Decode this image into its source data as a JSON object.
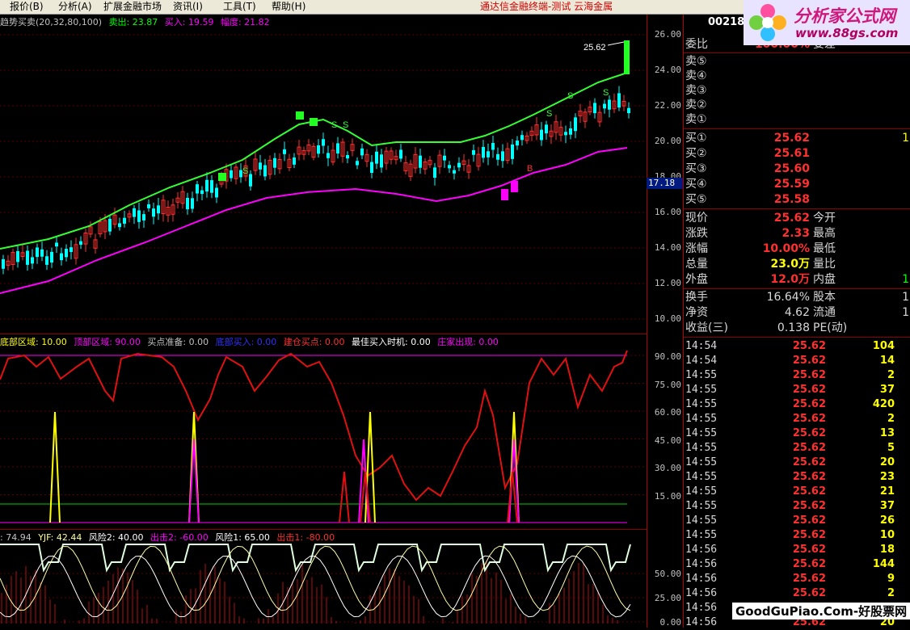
{
  "menu": {
    "items": [
      "报价(B)",
      "分析(A)",
      "扩展金融市场",
      "资讯(I)",
      "工具(T)",
      "帮助(H)"
    ],
    "app_title": "通达信金融终端-测试  云海金属"
  },
  "logo": {
    "brand": "分析家公式网",
    "url": "www.88gs.com"
  },
  "pane1": {
    "legend": [
      {
        "text": "趋势买卖(20,32,80,100)",
        "color": "#c0c0c0"
      },
      {
        "text": "卖出: 23.87",
        "color": "#00ff00"
      },
      {
        "text": "买入: 19.59",
        "color": "#ff00ff"
      },
      {
        "text": "幅度: 21.82",
        "color": "#ff00ff"
      }
    ],
    "last_price_label": "25.62",
    "marker_labels": [
      "S",
      "S",
      "S",
      "S",
      "B",
      "S",
      "S"
    ]
  },
  "pane2": {
    "legend": [
      {
        "text": "底部区域: 10.00",
        "color": "#ffff00"
      },
      {
        "text": "顶部区域: 90.00",
        "color": "#ff00ff"
      },
      {
        "text": "买点准备: 0.00",
        "color": "#c0c0c0"
      },
      {
        "text": "底部买入: 0.00",
        "color": "#3030ff"
      },
      {
        "text": "建仓买点: 0.00",
        "color": "#ff3030"
      },
      {
        "text": "最佳买入时机: 0.00",
        "color": "#ffffff"
      },
      {
        "text": "庄家出现: 0.00",
        "color": "#ff00ff"
      }
    ]
  },
  "pane3": {
    "legend": [
      {
        "text": ": 74.94",
        "color": "#c0c0c0"
      },
      {
        "text": "YJF: 42.44",
        "color": "#ffff99"
      },
      {
        "text": "风险2: 40.00",
        "color": "#ffffff"
      },
      {
        "text": "出击2: -60.00",
        "color": "#ff00ff"
      },
      {
        "text": "风险1: 65.00",
        "color": "#ffffff"
      },
      {
        "text": "出击1: -80.00",
        "color": "#ff3030"
      }
    ]
  },
  "axis": {
    "pane1_ticks": [
      "26.00",
      "24.00",
      "22.00",
      "20.00",
      "18.00",
      "16.00",
      "14.00",
      "12.00",
      "10.00"
    ],
    "pane2_ticks": [
      "90.00",
      "75.00",
      "60.00",
      "45.00",
      "30.00",
      "15.00"
    ],
    "pane3_ticks": [
      "50.00",
      "25.00",
      "0.00"
    ],
    "current_price_tag": "17.18"
  },
  "quote": {
    "code": "002182",
    "weibi": {
      "label": "委比",
      "value": "100.00%",
      "label2": "委差"
    },
    "sell": [
      {
        "label": "卖⑤"
      },
      {
        "label": "卖④"
      },
      {
        "label": "卖③"
      },
      {
        "label": "卖②"
      },
      {
        "label": "卖①"
      }
    ],
    "buy": [
      {
        "label": "买①",
        "price": "25.62",
        "vol": "1"
      },
      {
        "label": "买②",
        "price": "25.61",
        "vol": ""
      },
      {
        "label": "买③",
        "price": "25.60",
        "vol": ""
      },
      {
        "label": "买④",
        "price": "25.59",
        "vol": ""
      },
      {
        "label": "买⑤",
        "price": "25.58",
        "vol": ""
      }
    ],
    "stats": [
      {
        "label": "现价",
        "value": "25.62",
        "label2": "今开",
        "value2": ""
      },
      {
        "label": "涨跌",
        "value": "2.33",
        "label2": "最高",
        "value2": ""
      },
      {
        "label": "涨幅",
        "value": "10.00%",
        "label2": "最低",
        "value2": ""
      },
      {
        "label": "总量",
        "value": "23.0万",
        "label2": "量比",
        "value2": ""
      },
      {
        "label": "外盘",
        "value": "12.0万",
        "label2": "内盘",
        "value2": "1"
      }
    ],
    "stats2": [
      {
        "label": "换手",
        "value": "16.64%",
        "label2": "股本",
        "value2": "1"
      },
      {
        "label": "净资",
        "value": "4.62",
        "label2": "流通",
        "value2": "1"
      },
      {
        "label": "收益(三)",
        "value": "0.138",
        "label2": "PE(动)",
        "value2": ""
      }
    ],
    "ticks": [
      {
        "time": "14:54",
        "price": "25.62",
        "vol": "104"
      },
      {
        "time": "14:54",
        "price": "25.62",
        "vol": "14"
      },
      {
        "time": "14:55",
        "price": "25.62",
        "vol": "2"
      },
      {
        "time": "14:55",
        "price": "25.62",
        "vol": "37"
      },
      {
        "time": "14:55",
        "price": "25.62",
        "vol": "420"
      },
      {
        "time": "14:55",
        "price": "25.62",
        "vol": "2"
      },
      {
        "time": "14:55",
        "price": "25.62",
        "vol": "13"
      },
      {
        "time": "14:55",
        "price": "25.62",
        "vol": "5"
      },
      {
        "time": "14:55",
        "price": "25.62",
        "vol": "20"
      },
      {
        "time": "14:55",
        "price": "25.62",
        "vol": "23"
      },
      {
        "time": "14:55",
        "price": "25.62",
        "vol": "21"
      },
      {
        "time": "14:55",
        "price": "25.62",
        "vol": "37"
      },
      {
        "time": "14:55",
        "price": "25.62",
        "vol": "26"
      },
      {
        "time": "14:55",
        "price": "25.62",
        "vol": "10"
      },
      {
        "time": "14:56",
        "price": "25.62",
        "vol": "18"
      },
      {
        "time": "14:56",
        "price": "25.62",
        "vol": "144"
      },
      {
        "time": "14:56",
        "price": "25.62",
        "vol": "9"
      },
      {
        "time": "14:56",
        "price": "25.62",
        "vol": "2"
      },
      {
        "time": "14:56",
        "price": "25.62",
        "vol": "1"
      },
      {
        "time": "14:56",
        "price": "25.62",
        "vol": "20"
      }
    ]
  },
  "footer_watermark": "GoodGuPiao.Com-好股票网",
  "colors": {
    "up": "#ff3030",
    "down": "#00ffff",
    "sell_line": "#33ff33",
    "buy_line": "#ff00ff",
    "osc": "#e01010"
  }
}
